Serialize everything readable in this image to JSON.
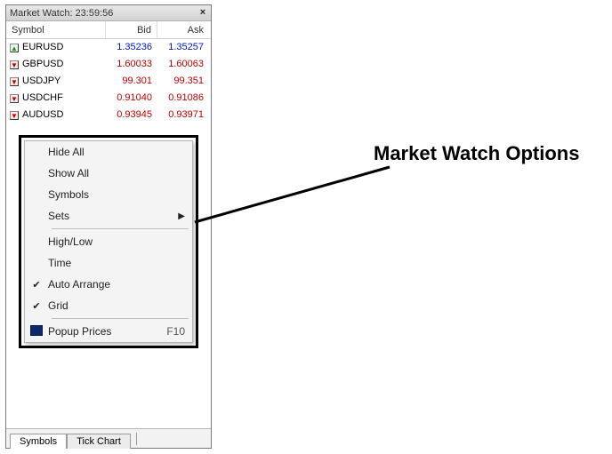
{
  "window": {
    "title_prefix": "Market Watch:",
    "time": "23:59:56",
    "close_glyph": "×"
  },
  "columns": {
    "symbol": "Symbol",
    "bid": "Bid",
    "ask": "Ask"
  },
  "rows": [
    {
      "dir": "up",
      "symbol": "EURUSD",
      "bid": "1.35236",
      "ask": "1.35257"
    },
    {
      "dir": "down",
      "symbol": "GBPUSD",
      "bid": "1.60033",
      "ask": "1.60063"
    },
    {
      "dir": "down",
      "symbol": "USDJPY",
      "bid": "99.301",
      "ask": "99.351"
    },
    {
      "dir": "down",
      "symbol": "USDCHF",
      "bid": "0.91040",
      "ask": "0.91086"
    },
    {
      "dir": "down",
      "symbol": "AUDUSD",
      "bid": "0.93945",
      "ask": "0.93971"
    }
  ],
  "context_menu": {
    "hide_all": "Hide All",
    "show_all": "Show All",
    "symbols": "Symbols",
    "sets": "Sets",
    "high_low": "High/Low",
    "time": "Time",
    "auto_arrange": "Auto Arrange",
    "grid": "Grid",
    "popup_prices": "Popup Prices",
    "popup_shortcut": "F10",
    "auto_arrange_checked": true,
    "grid_checked": true
  },
  "tabs": {
    "symbols": "Symbols",
    "tick_chart": "Tick Chart"
  },
  "annotation": {
    "label": "Market Watch Options"
  }
}
